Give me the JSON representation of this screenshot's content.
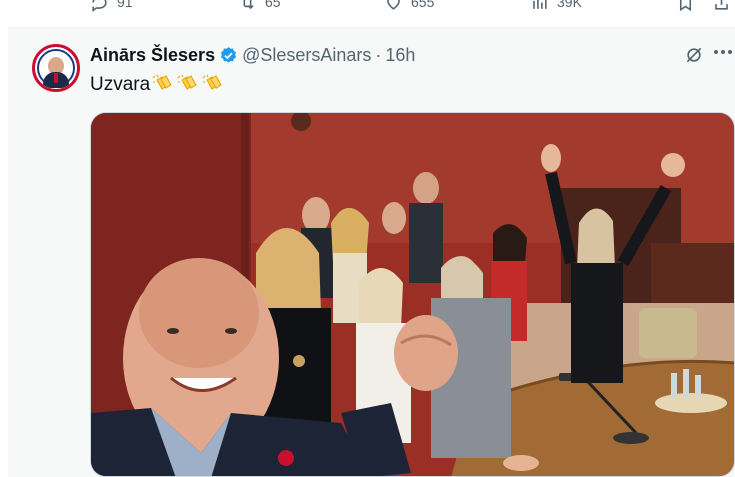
{
  "previous_tweet": {
    "actions": [
      {
        "name": "reply",
        "count": "91"
      },
      {
        "name": "retweet",
        "count": "65"
      },
      {
        "name": "like",
        "count": "655"
      },
      {
        "name": "views",
        "count": "39K"
      }
    ]
  },
  "tweet": {
    "author_name": "Ainārs Šlesers",
    "handle": "@SlesersAinars",
    "separator": "·",
    "time": "16h",
    "text": "Uzvara",
    "emoji_count": 3,
    "emoji_name": "clapping-hands",
    "colors": {
      "verified": "#1d9bf0",
      "accent_red": "#c8102e",
      "muted": "#536471"
    }
  },
  "icons": {
    "verified": "verified-badge-icon",
    "grok": "grok-icon",
    "more": "more-options-icon",
    "bookmark": "bookmark-icon",
    "share": "share-icon"
  }
}
